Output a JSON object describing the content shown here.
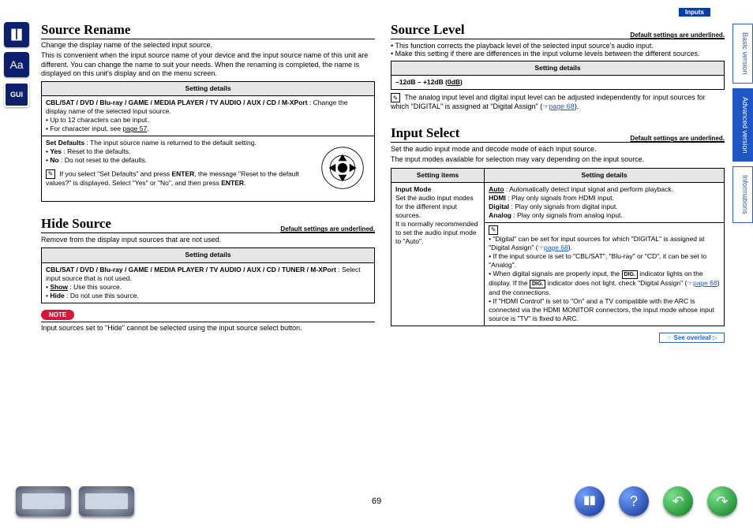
{
  "header": {
    "section_label": "Inputs"
  },
  "tabs": {
    "basic": "Basic version",
    "advanced": "Advanced version",
    "info": "Informations"
  },
  "default_note": "Default settings are underlined.",
  "page_number": "69",
  "see_overleaf": "See overleaf",
  "col_hdr": {
    "details": "Setting details",
    "items": "Setting items"
  },
  "source_rename": {
    "title": "Source Rename",
    "intro1": "Change the display name of the selected input source.",
    "intro2": "This is convenient when the input source name of your device and the input source name of this unit are different. You can change the name to suit your needs. When the renaming is completed, the name is displayed on this unit's display and on the menu screen.",
    "row1_a": "CBL/SAT / DVD / Blu-ray / GAME / MEDIA PLAYER / TV AUDIO / AUX / CD / M-XPort",
    "row1_b": " : Change the display name of the selected input source.",
    "row1_c": "Up to 12 characters can be input.",
    "row1_d": "For character input, see ",
    "row1_d_link": "page 57",
    "row2_a": "Set Defaults",
    "row2_b": " : The input source name is returned to the default setting.",
    "row2_yes": "Yes",
    "row2_yes_t": " : Reset to the defaults.",
    "row2_no": "No",
    "row2_no_t": " : Do not reset to the defaults.",
    "tip": "If you select \"Set Defaults\" and press ENTER, the message \"Reset to the default values?\" is displayed. Select \"Yes\" or \"No\", and then press ENTER."
  },
  "hide_source": {
    "title": "Hide Source",
    "intro": "Remove from the display input sources that are not used.",
    "row_a": "CBL/SAT / DVD / Blu-ray / GAME / MEDIA PLAYER / TV AUDIO / AUX / CD / TUNER / M-XPort",
    "row_b": " : Select input source that is not used.",
    "show": "Show",
    "show_t": " : Use this source.",
    "hide": "Hide",
    "hide_t": " : Do not use this source.",
    "note_label": "NOTE",
    "note_text": "Input sources set to \"Hide\" cannot be selected using the input source select button."
  },
  "source_level": {
    "title": "Source Level",
    "b1": "This function corrects the playback level of the selected input source's audio input.",
    "b2": "Make this setting if there are differences in the input volume levels between the different sources.",
    "range": "–12dB – +12dB (0dB)",
    "tip": "The analog input level and digital input level can be adjusted independently for input sources for which \"DIGITAL\" is assigned at \"Digital Assign\" (",
    "tip_link": "page 68",
    "tip_end": ")."
  },
  "input_select": {
    "title": "Input Select",
    "intro1": "Set the audio input mode and decode mode of each input source.",
    "intro2": "The input modes available for selection may vary depending on the input source.",
    "left_title": "Input Mode",
    "left_desc": "Set the audio input modes for the different input sources.\nIt is normally recommended to set the audio input mode to \"Auto\".",
    "auto": "Auto",
    "auto_t": " : Automatically detect input signal and perform playback.",
    "hdmi": "HDMI",
    "hdmi_t": " : Play only signals from HDMI input.",
    "digital": "Digital",
    "digital_t": " : Play only signals from digital input.",
    "analog": "Analog",
    "analog_t": " : Play only signals from analog input.",
    "n1": "\"Digital\" can be set for input sources for which \"DIGITAL\" is assigned at \"Digital Assign\" (",
    "n1_link": "page 68",
    "n1_end": ").",
    "n2": "If the input source is set to \"CBL/SAT\", \"Blu-ray\" or \"CD\", it can be set to \"Analog\".",
    "n3a": "When digital signals are properly input, the ",
    "n3b": " indicator lights on the display. If the ",
    "n3c": " indicator does not light, check \"Digital Assign\" (",
    "n3_link": "page 68",
    "n3d": ") and the connections.",
    "n4": "If \"HDMI Control\" is set to \"On\" and a TV compatible with the ARC is connected via the HDMI MONITOR connectors, the input mode whose input source is \"TV\" is fixed to ARC.",
    "dig": "DIG."
  }
}
